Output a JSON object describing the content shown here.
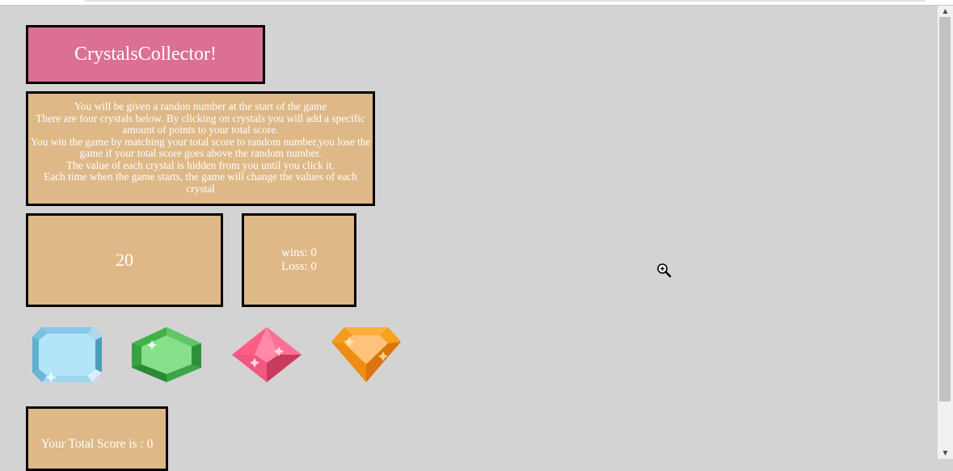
{
  "game": {
    "title": "CrystalsCollector!",
    "instructions": [
      "You will be given a randon number at the start of the game",
      "There are four crystals below. By clicking on crystals you will add a specific amount of points to your total score.",
      "You win the game by matching your total score to random number,you lose the game if your total score goes above the random number.",
      "The value of each crystal is hidden from you until you click it.",
      "Each time when the game starts, the game will change the values of each crystal"
    ],
    "target_number": "20",
    "wins": "wins: 0",
    "losses": "Loss: 0",
    "total_score": "Your Total Score is : 0"
  },
  "crystals": [
    {
      "name": "blue-crystal-icon",
      "color": "#7fc6e6"
    },
    {
      "name": "green-crystal-icon",
      "color": "#3fb24a"
    },
    {
      "name": "pink-crystal-icon",
      "color": "#ff5d86"
    },
    {
      "name": "orange-crystal-icon",
      "color": "#f7a21b"
    }
  ],
  "colors": {
    "background": "#d3d3d3",
    "title_bg": "#db7093",
    "panel_bg": "#deb887"
  }
}
